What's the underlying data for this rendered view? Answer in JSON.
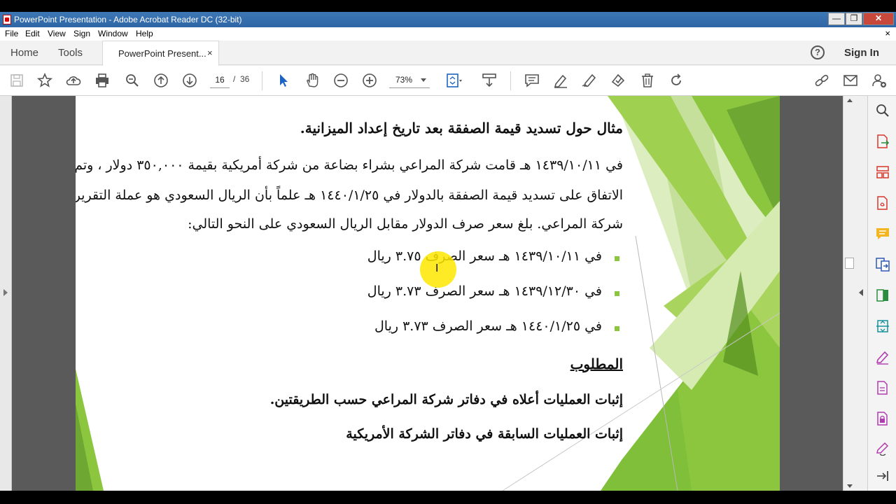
{
  "window": {
    "title": "PowerPoint Presentation - Adobe Acrobat Reader DC (32-bit)",
    "min_glyph": "—",
    "max_glyph": "❐",
    "close_glyph": "✕"
  },
  "menu": {
    "items": [
      "File",
      "Edit",
      "View",
      "Sign",
      "Window",
      "Help"
    ],
    "close_glyph": "×"
  },
  "tabs": {
    "home": "Home",
    "tools": "Tools",
    "document": "PowerPoint Present...",
    "close_glyph": "×",
    "help_glyph": "?",
    "signin": "Sign In"
  },
  "toolbar": {
    "current_page": "16",
    "page_separator": "/",
    "total_pages": "36",
    "zoom": "73%",
    "icons": [
      "save-icon",
      "bookmark-star-icon",
      "upload-cloud-icon",
      "print-icon",
      "zoom-search-icon",
      "page-up-icon",
      "page-down-icon",
      "select-arrow-icon",
      "hand-tool-icon",
      "zoom-out-icon",
      "zoom-in-icon",
      "fit-page-icon",
      "scroll-mode-icon",
      "comment-icon",
      "highlight-pen-icon",
      "draw-icon",
      "stamp-icon",
      "delete-icon",
      "rotate-icon",
      "link-icon",
      "email-icon",
      "add-user-icon"
    ]
  },
  "document": {
    "heading": "مثال حول تسديد قيمة الصفقة بعد تاريخ إعداد الميزانية.",
    "paragraph": [
      "في ١٤٣٩/١٠/١١ هـ قامت شركة المراعي بشراء بضاعة من شركة أمريكية بقيمة ٣٥٠,٠٠٠ دولار ، وتم",
      "الاتفاق على تسديد قيمة الصفقة بالدولار في ١٤٤٠/١/٢٥ هـ علماً بأن الريال السعودي هو عملة التقرير في",
      "شركة المراعي. بلغ سعر صرف الدولار مقابل الريال السعودي على النحو التالي:"
    ],
    "bullets": [
      "في ١٤٣٩/١٠/١١ هـ سعر الصرف ٣.٧٥ ريال",
      "في ١٤٣٩/١٢/٣٠ هـ سعر الصرف ٣.٧٣ ريال",
      "في ١٤٤٠/١/٢٥ هـ سعر الصرف ٣.٧٣ ريال"
    ],
    "required_heading": "المطلوب",
    "tasks": [
      "إثبات العمليات أعلاه في دفاتر شركة المراعي حسب الطريقتين.",
      "إثبات العمليات السابقة في دفاتر الشركة الأمريكية"
    ],
    "cursor_glyph": "I"
  },
  "colors": {
    "accent_green": "#8cc63f",
    "light_green": "#c5e09a",
    "titlebar": "#2e65a6",
    "cursor_highlight": "#ffe600"
  },
  "right_tools": [
    "zoom-tool-icon",
    "export-pdf-icon",
    "organize-pages-icon",
    "create-pdf-icon",
    "comment-tool-icon",
    "combine-files-icon",
    "compress-pdf-icon",
    "enhance-scan-icon",
    "fill-sign-icon",
    "edit-pdf-icon",
    "protect-icon",
    "more-tools-icon",
    "collapse-pane-icon"
  ]
}
